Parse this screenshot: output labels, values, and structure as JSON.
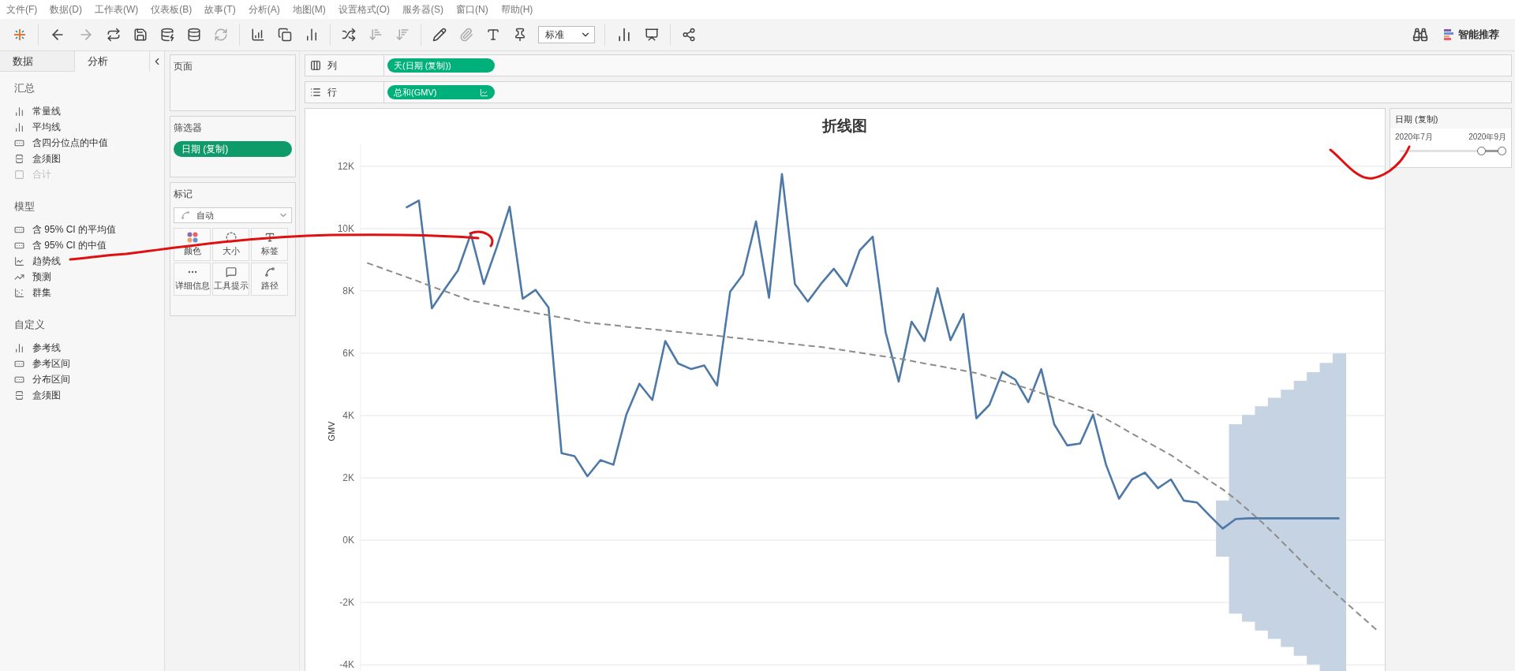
{
  "menu": [
    "文件(F)",
    "数据(D)",
    "工作表(W)",
    "仪表板(B)",
    "故事(T)",
    "分析(A)",
    "地图(M)",
    "设置格式(O)",
    "服务器(S)",
    "窗口(N)",
    "帮助(H)"
  ],
  "toolbar": {
    "mark_select": "标准",
    "recommend": "智能推荐"
  },
  "side_tabs": [
    {
      "label": "数据",
      "selected": false
    },
    {
      "label": "分析",
      "selected": true
    }
  ],
  "analytics": [
    {
      "title": "汇总",
      "items": [
        {
          "label": "常量线",
          "kind": "line",
          "disabled": false
        },
        {
          "label": "平均线",
          "kind": "line",
          "disabled": false
        },
        {
          "label": "含四分位点的中值",
          "kind": "band",
          "disabled": false
        },
        {
          "label": "盒须图",
          "kind": "box",
          "disabled": false
        },
        {
          "label": "合计",
          "kind": "total",
          "disabled": true
        }
      ]
    },
    {
      "title": "模型",
      "items": [
        {
          "label": "含 95% CI 的平均值",
          "kind": "band",
          "disabled": false
        },
        {
          "label": "含 95% CI 的中值",
          "kind": "band",
          "disabled": false
        },
        {
          "label": "趋势线",
          "kind": "trend",
          "disabled": false
        },
        {
          "label": "预测",
          "kind": "forecast",
          "disabled": false
        },
        {
          "label": "群集",
          "kind": "cluster",
          "disabled": false
        }
      ]
    },
    {
      "title": "自定义",
      "items": [
        {
          "label": "参考线",
          "kind": "line",
          "disabled": false
        },
        {
          "label": "参考区间",
          "kind": "band",
          "disabled": false
        },
        {
          "label": "分布区间",
          "kind": "band",
          "disabled": false
        },
        {
          "label": "盒须图",
          "kind": "box",
          "disabled": false
        }
      ]
    }
  ],
  "pages": {
    "title": "页面"
  },
  "filters": {
    "title": "筛选器",
    "pills": [
      "日期 (复制)"
    ]
  },
  "marks": {
    "title": "标记",
    "type": "自动",
    "buttons": [
      {
        "label": "颜色",
        "kind": "color"
      },
      {
        "label": "大小",
        "kind": "size"
      },
      {
        "label": "标签",
        "kind": "label"
      },
      {
        "label": "详细信息",
        "kind": "detail"
      },
      {
        "label": "工具提示",
        "kind": "tooltip"
      },
      {
        "label": "路径",
        "kind": "path"
      }
    ]
  },
  "shelves": [
    {
      "label": "列",
      "kind": "columns",
      "pill": "天(日期 (复制))"
    },
    {
      "label": "行",
      "kind": "rows",
      "pill": "总和(GMV)"
    }
  ],
  "chart": {
    "chart_data": {
      "type": "line",
      "title": "折线图",
      "ylabel": "GMV",
      "categories": [
        null,
        null,
        null,
        null,
        null,
        null,
        null,
        null,
        null,
        null,
        null,
        null,
        null,
        null,
        null,
        null,
        null,
        null,
        null,
        null,
        null,
        null,
        null,
        null,
        null,
        null,
        null,
        null,
        null,
        null,
        null,
        null,
        null,
        null,
        null,
        null,
        null,
        null,
        null,
        null,
        null,
        null,
        null,
        null,
        null,
        null,
        null,
        null,
        null,
        null,
        null,
        null,
        null,
        null,
        null,
        null,
        null,
        null,
        null,
        null,
        null,
        null,
        null,
        null,
        null,
        null,
        null,
        null,
        null,
        null,
        null,
        null,
        null,
        null,
        null,
        null,
        null,
        null,
        null
      ],
      "series": [
        {
          "color": "#4e79a7",
          "errors": [
            null,
            null,
            null,
            null,
            null,
            null,
            null,
            null,
            null,
            null,
            null,
            null,
            null,
            null,
            null,
            null,
            null,
            null,
            null,
            null,
            null,
            null,
            null,
            null,
            null,
            null,
            null,
            null,
            null,
            null,
            null,
            null,
            null,
            null,
            null,
            null,
            null,
            null,
            null,
            null,
            null,
            null,
            null,
            null,
            null,
            null,
            null,
            null,
            null,
            null,
            null,
            null,
            null,
            null,
            null,
            null,
            null,
            null,
            null,
            null,
            null,
            null,
            null,
            null,
            null,
            null,
            900,
            3040,
            3320,
            3600,
            3870,
            4130,
            4410,
            4690,
            4990,
            5290,
            null,
            null,
            null
          ],
          "values": [
            null,
            null,
            null,
            10670,
            10900,
            7440,
            8060,
            8650,
            9830,
            8220,
            9400,
            10700,
            7750,
            8030,
            7470,
            2790,
            2700,
            2050,
            2570,
            2420,
            4030,
            5020,
            4500,
            6390,
            5670,
            5490,
            5610,
            4960,
            7970,
            8530,
            10230,
            7780,
            11750,
            8220,
            7660,
            8220,
            8710,
            8160,
            9300,
            9740,
            6670,
            5090,
            7010,
            6390,
            8090,
            6420,
            7260,
            3910,
            4340,
            5400,
            5150,
            4430,
            5490,
            3720,
            3040,
            3100,
            4030,
            2420,
            1330,
            1950,
            2170,
            1670,
            1950,
            1270,
            1210,
            780,
            370,
            680,
            700,
            700,
            700,
            700,
            700,
            700,
            700,
            700,
            null,
            null,
            null
          ]
        },
        {
          "line_style": "dashed",
          "color": "#8c8c8c",
          "values": [
            8900,
            8750,
            8600,
            8450,
            8300,
            8140,
            7990,
            7840,
            7690,
            7610,
            7530,
            7450,
            7370,
            7290,
            7220,
            7140,
            7060,
            6980,
            6940,
            6900,
            6850,
            6810,
            6770,
            6730,
            6680,
            6640,
            6600,
            6560,
            6510,
            6470,
            6420,
            6380,
            6330,
            6290,
            6240,
            6200,
            6140,
            6080,
            6020,
            5950,
            5890,
            5830,
            5750,
            5670,
            5600,
            5520,
            5440,
            5360,
            5240,
            5110,
            4990,
            4860,
            4720,
            4570,
            4420,
            4270,
            4120,
            3890,
            3660,
            3420,
            3190,
            2960,
            2730,
            2450,
            2180,
            1900,
            1630,
            1310,
            950,
            580,
            190,
            -230,
            -650,
            -1070,
            -1450,
            -1820,
            -2190,
            -2560,
            -2930
          ]
        }
      ],
      "ylim": [
        -4250,
        12730
      ],
      "grid": true,
      "yticks": [
        {
          "value": 12000,
          "label": "12K"
        },
        {
          "value": 10000,
          "label": "10K"
        },
        {
          "value": 8000,
          "label": "8K"
        },
        {
          "value": 6000,
          "label": "6K"
        },
        {
          "value": 4000,
          "label": "4K"
        },
        {
          "value": 2000,
          "label": "2K"
        },
        {
          "value": 0,
          "label": "0K"
        },
        {
          "value": -2000,
          "label": "-2K"
        },
        {
          "value": -4000,
          "label": "-4K"
        }
      ]
    }
  },
  "legend": {
    "title": "日期 (复制)",
    "from": "2020年7月",
    "to": "2020年9月",
    "start": {
      "level": 0.8
    },
    "end": {
      "level": 1
    }
  }
}
